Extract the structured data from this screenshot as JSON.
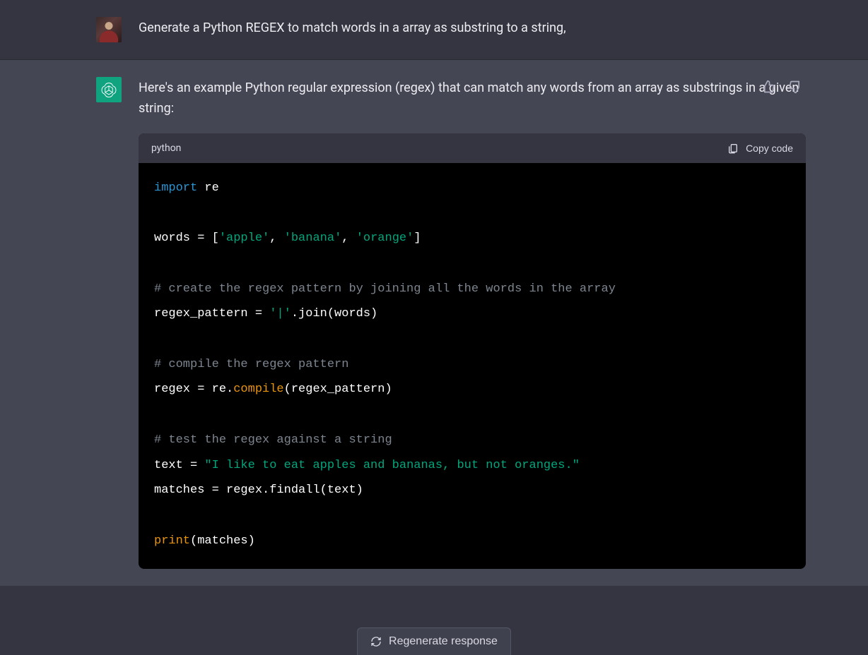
{
  "user_message": "Generate a Python REGEX to match words in a array as substring to a string,",
  "assistant_intro": "Here's an example Python regular expression (regex) that can match any words from an array as substrings in a given string:",
  "code": {
    "language": "python",
    "copy_label": "Copy code",
    "lines": [
      [
        {
          "t": "import ",
          "c": "tok-kw"
        },
        {
          "t": "re",
          "c": ""
        }
      ],
      [],
      [
        {
          "t": "words = [",
          "c": ""
        },
        {
          "t": "'apple'",
          "c": "tok-str"
        },
        {
          "t": ", ",
          "c": ""
        },
        {
          "t": "'banana'",
          "c": "tok-str"
        },
        {
          "t": ", ",
          "c": ""
        },
        {
          "t": "'orange'",
          "c": "tok-str"
        },
        {
          "t": "]",
          "c": ""
        }
      ],
      [],
      [
        {
          "t": "# create the regex pattern by joining all the words in the array",
          "c": "tok-cm"
        }
      ],
      [
        {
          "t": "regex_pattern = ",
          "c": ""
        },
        {
          "t": "'|'",
          "c": "tok-str"
        },
        {
          "t": ".join(words)",
          "c": ""
        }
      ],
      [],
      [
        {
          "t": "# compile the regex pattern",
          "c": "tok-cm"
        }
      ],
      [
        {
          "t": "regex = re.",
          "c": ""
        },
        {
          "t": "compile",
          "c": "tok-fn"
        },
        {
          "t": "(regex_pattern)",
          "c": ""
        }
      ],
      [],
      [
        {
          "t": "# test the regex against a string",
          "c": "tok-cm"
        }
      ],
      [
        {
          "t": "text = ",
          "c": ""
        },
        {
          "t": "\"I like to eat apples and bananas, but not oranges.\"",
          "c": "tok-str"
        }
      ],
      [
        {
          "t": "matches = regex.findall(text)",
          "c": ""
        }
      ],
      [],
      [
        {
          "t": "print",
          "c": "tok-builtin"
        },
        {
          "t": "(matches)",
          "c": ""
        }
      ]
    ]
  },
  "regenerate_label": "Regenerate response"
}
